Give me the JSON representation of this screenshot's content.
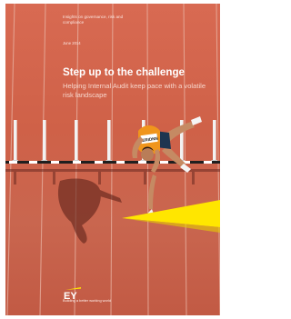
{
  "report": {
    "series_label": "Insights on governance, risk and compliance",
    "date": "June 2014",
    "title": "Step up to the challenge",
    "subtitle": "Helping Internal Audit keep pace with a volatile risk landscape"
  },
  "brand": {
    "logo_text": "EY",
    "tagline": "Building a better working world",
    "accent_color": "#ffe600"
  },
  "athlete": {
    "bib": "ERIDNN"
  }
}
